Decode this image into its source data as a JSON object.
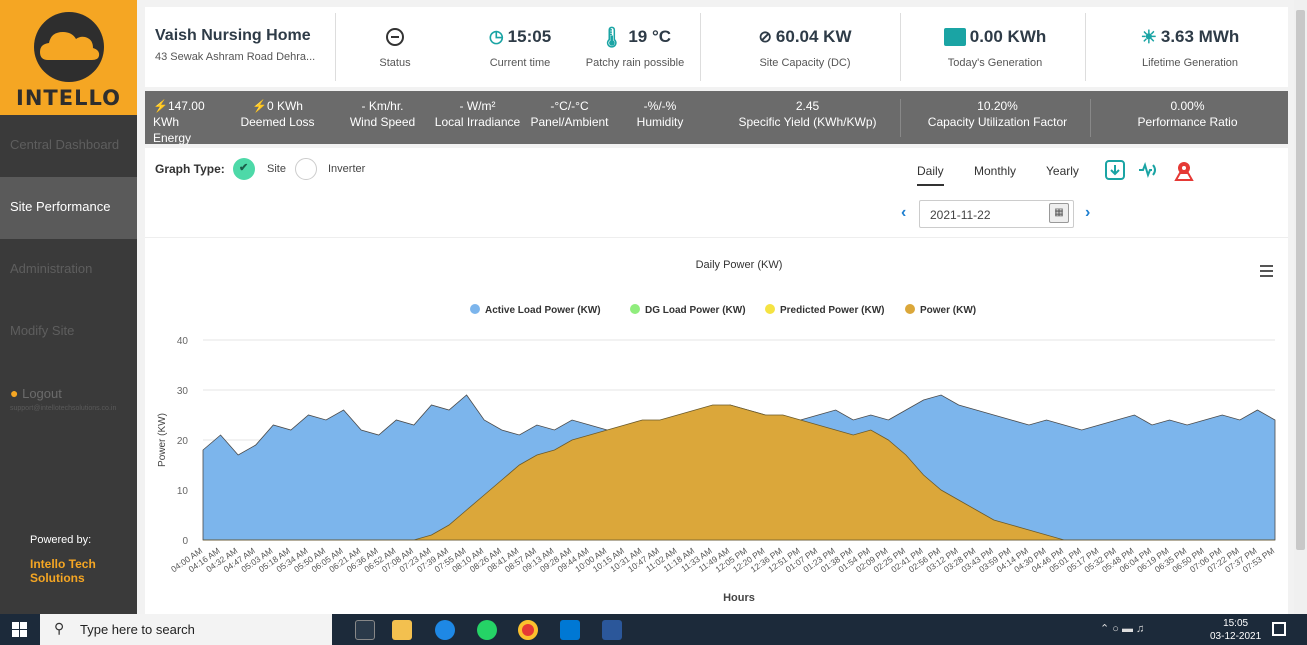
{
  "brand": {
    "logo_text": "INTELLO",
    "accent": "#f5a623"
  },
  "sidebar": {
    "items": [
      {
        "label": "Central Dashboard"
      },
      {
        "label": "Site Performance"
      },
      {
        "label": "Administration"
      },
      {
        "label": "Modify Site"
      }
    ],
    "logout_label": "Logout",
    "support_email": "support@intellotechsolutions.co.in",
    "powered_by": "Powered by:",
    "company": "Intello Tech Solutions"
  },
  "header": {
    "site_name": "Vaish Nursing Home",
    "address": "43 Sewak Ashram Road Dehra...",
    "status_label": "Status",
    "time_value": "15:05",
    "time_label": "Current time",
    "temp_value": "19 °C",
    "weather_label": "Patchy rain possible",
    "capacity_value": "60.04 KW",
    "capacity_label": "Site Capacity (DC)",
    "today_value": "0.00 KWh",
    "today_label": "Today's Generation",
    "lifetime_value": "3.63 MWh",
    "lifetime_label": "Lifetime Generation"
  },
  "metrics": {
    "energy_value": "147.00 KWh",
    "energy_label": "Energy",
    "deemed_value": "0 KWh",
    "deemed_label": "Deemed Loss",
    "wind_value": "- Km/hr.",
    "wind_label": "Wind Speed",
    "irr_value": "- W/m²",
    "irr_label": "Local Irradiance",
    "panel_value": "-°C/-°C",
    "panel_label": "Panel/Ambient",
    "hum_value": "-%/-%",
    "hum_label": "Humidity",
    "yield_value": "2.45",
    "yield_label": "Specific Yield (KWh/KWp)",
    "cuf_value": "10.20%",
    "cuf_label": "Capacity Utilization Factor",
    "pr_value": "0.00%",
    "pr_label": "Performance Ratio"
  },
  "controls": {
    "graph_type_label": "Graph Type:",
    "site_label": "Site",
    "inverter_label": "Inverter",
    "periods": [
      "Daily",
      "Monthly",
      "Yearly"
    ],
    "active_period": "Daily",
    "date": "2021-11-22"
  },
  "chart_data": {
    "type": "area",
    "title": "Daily Power (KW)",
    "xlabel": "Hours",
    "ylabel": "Power (KW)",
    "ylim": [
      0,
      40
    ],
    "yticks": [
      0,
      10,
      20,
      30,
      40
    ],
    "grid": true,
    "legend_position": "top",
    "x_tick_labels": [
      "04:00 AM",
      "04:16 AM",
      "04:32 AM",
      "04:47 AM",
      "05:03 AM",
      "05:18 AM",
      "05:34 AM",
      "05:50 AM",
      "06:05 AM",
      "06:21 AM",
      "06:36 AM",
      "06:52 AM",
      "07:08 AM",
      "07:23 AM",
      "07:39 AM",
      "07:55 AM",
      "08:10 AM",
      "08:26 AM",
      "08:41 AM",
      "08:57 AM",
      "09:13 AM",
      "09:28 AM",
      "09:44 AM",
      "10:00 AM",
      "10:15 AM",
      "10:31 AM",
      "10:47 AM",
      "11:02 AM",
      "11:18 AM",
      "11:33 AM",
      "11:49 AM",
      "12:05 PM",
      "12:20 PM",
      "12:36 PM",
      "12:51 PM",
      "01:07 PM",
      "01:23 PM",
      "01:38 PM",
      "01:54 PM",
      "02:09 PM",
      "02:25 PM",
      "02:41 PM",
      "02:56 PM",
      "03:12 PM",
      "03:28 PM",
      "03:43 PM",
      "03:59 PM",
      "04:14 PM",
      "04:30 PM",
      "04:46 PM",
      "05:01 PM",
      "05:17 PM",
      "05:32 PM",
      "05:48 PM",
      "06:04 PM",
      "06:19 PM",
      "06:35 PM",
      "06:50 PM",
      "07:06 PM",
      "07:22 PM",
      "07:37 PM",
      "07:53 PM"
    ],
    "series": [
      {
        "name": "Active Load Power (KW)",
        "color": "#7cb5ec",
        "values": [
          18,
          21,
          17,
          19,
          23,
          22,
          25,
          24,
          26,
          22,
          21,
          24,
          23,
          27,
          26,
          29,
          24,
          22,
          21,
          23,
          22,
          24,
          23,
          22,
          21,
          22,
          23,
          24,
          25,
          26,
          27,
          26,
          25,
          24,
          24,
          25,
          26,
          24,
          25,
          24,
          26,
          28,
          29,
          27,
          26,
          25,
          24,
          23,
          24,
          23,
          22,
          23,
          24,
          25,
          23,
          24,
          23,
          24,
          25,
          24,
          26,
          24
        ]
      },
      {
        "name": "DG Load Power (KW)",
        "color": "#90ed7d",
        "values": []
      },
      {
        "name": "Predicted Power (KW)",
        "color": "#f5e342",
        "values": []
      },
      {
        "name": "Power (KW)",
        "color": "#dba73a",
        "values": [
          0,
          0,
          0,
          0,
          0,
          0,
          0,
          0,
          0,
          0,
          0,
          0,
          0,
          1,
          3,
          6,
          9,
          12,
          15,
          17,
          18,
          20,
          21,
          22,
          23,
          24,
          24,
          25,
          26,
          27,
          27,
          26,
          25,
          25,
          24,
          23,
          22,
          21,
          22,
          20,
          17,
          13,
          10,
          8,
          6,
          4,
          3,
          2,
          1,
          0,
          0,
          0,
          0,
          0,
          0,
          0,
          0,
          0,
          0,
          0,
          0,
          0
        ]
      }
    ]
  }
}
